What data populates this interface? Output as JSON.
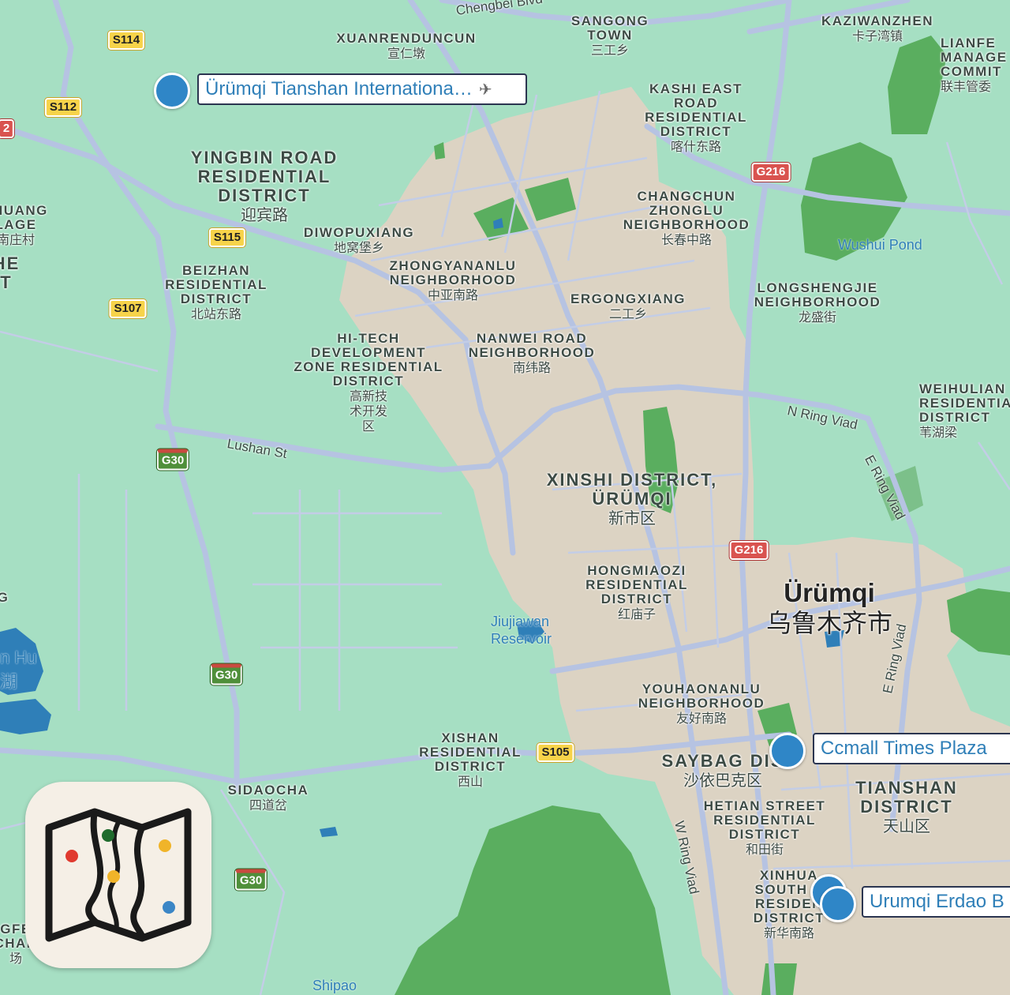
{
  "map": {
    "city": {
      "en": "Ürümqi",
      "zh": "乌鲁木齐市"
    },
    "districts": [
      {
        "en": "XUANRENDUNCUN",
        "zh": "宣仁墩"
      },
      {
        "en": "SANGONG TOWN",
        "zh": "三工乡"
      },
      {
        "en": "KAZIWANZHEN",
        "zh": "卡子湾镇"
      },
      {
        "en": "LIANFE MANAGE COMMIT",
        "zh": "联丰管委"
      },
      {
        "en": "KASHI EAST ROAD RESIDENTIAL DISTRICT",
        "zh": "喀什东路"
      },
      {
        "en": "YINGBIN ROAD RESIDENTIAL DISTRICT",
        "zh": "迎宾路"
      },
      {
        "en": "ZHUANG LAGE",
        "zh": "南庄村"
      },
      {
        "en": "DIWOPUXIANG",
        "zh": "地窝堡乡"
      },
      {
        "en": "CHANGCHUN ZHONGLU NEIGHBORHOOD",
        "zh": "长春中路"
      },
      {
        "en": "ZHONGYANANLU NEIGHBORHOOD",
        "zh": "中亚南路"
      },
      {
        "en": "BEIZHAN RESIDENTIAL DISTRICT",
        "zh": "北站东路"
      },
      {
        "en": "ERGONGXIANG",
        "zh": "二工乡"
      },
      {
        "en": "LONGSHENGJIE NEIGHBORHOOD",
        "zh": "龙盛街"
      },
      {
        "en": "HI-TECH DEVELOPMENT ZONE RESIDENTIAL DISTRICT",
        "zh": "高新技术开发区"
      },
      {
        "en": "NANWEI ROAD NEIGHBORHOOD",
        "zh": "南纬路"
      },
      {
        "en": "WEIHULIAN RESIDENTIA DISTRICT",
        "zh": "苇湖梁"
      },
      {
        "en": "XINSHI DISTRICT, ÜRÜMQI",
        "zh": "新市区"
      },
      {
        "en": "HONGMIAOZI RESIDENTIAL DISTRICT",
        "zh": "红庙子"
      },
      {
        "en": "YOUHAONANLU NEIGHBORHOOD",
        "zh": "友好南路"
      },
      {
        "en": "XISHAN RESIDENTIAL DISTRICT",
        "zh": "西山"
      },
      {
        "en": "SAYBAG DIS",
        "zh": "沙依巴克区"
      },
      {
        "en": "TIANSHAN DISTRICT",
        "zh": "天山区"
      },
      {
        "en": "SIDAOCHA",
        "zh": "四道岔"
      },
      {
        "en": "HETIAN STREET RESIDENTIAL DISTRICT",
        "zh": "和田街"
      },
      {
        "en": "XINHUA SOUTH R RESIDEN DISTRICT",
        "zh": "新华南路"
      },
      {
        "en": "GFE CHAN",
        "zh": "场"
      },
      {
        "en": "HE T",
        "zh": ""
      },
      {
        "en": "G",
        "zh": ""
      }
    ],
    "roads": [
      "Chengbei Blvd",
      "Lushan St",
      "N Ring Viad",
      "E Ring Viad",
      "W Ring Viad",
      "E Ring Viad"
    ],
    "water": [
      "Wushui Pond",
      "Jiujiawan Reservoir",
      "Shipao",
      "n Hu",
      "湖"
    ],
    "shields": {
      "yellow": [
        "S114",
        "S112",
        "S115",
        "S107",
        "S105"
      ],
      "red": [
        "G216",
        "G216",
        "2"
      ],
      "green": [
        "G30",
        "G30",
        "G30"
      ]
    },
    "pins": [
      {
        "label": "Ürümqi Tianshan Internationa…",
        "icon": "airplane-icon"
      },
      {
        "label": "Ccmall Times Plaza"
      },
      {
        "label": "Urumqi Erdao B"
      }
    ]
  },
  "colors": {
    "land": "#a6dfc3",
    "urban": "#dcd3c3",
    "park": "#5aae5f",
    "water": "#2f7fb8",
    "pin": "#2f86c7"
  },
  "app_icon": {
    "name": "map-app-icon"
  }
}
